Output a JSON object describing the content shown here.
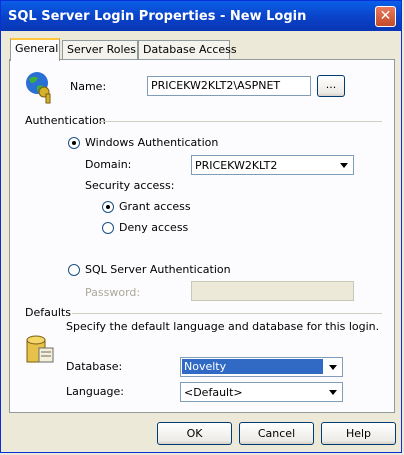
{
  "window": {
    "title": "SQL Server Login Properties - New Login",
    "close_glyph": "✕"
  },
  "tabs": [
    {
      "label": "General",
      "active": true
    },
    {
      "label": "Server Roles",
      "active": false
    },
    {
      "label": "Database Access",
      "active": false
    }
  ],
  "general": {
    "name_label": "Name:",
    "name_value": "PRICEKW2KLT2\\ASPNET",
    "browse_label": "...",
    "auth_section": "Authentication",
    "windows_auth_label": "Windows Authentication",
    "windows_auth_selected": true,
    "domain_label": "Domain:",
    "domain_value": "PRICEKW2KLT2",
    "security_access_label": "Security access:",
    "grant_label": "Grant access",
    "grant_selected": true,
    "deny_label": "Deny access",
    "sql_auth_label": "SQL Server Authentication",
    "password_label": "Password:",
    "password_value": "",
    "defaults_section": "Defaults",
    "defaults_desc": "Specify the default language and database for this login.",
    "database_label": "Database:",
    "database_value": "Novelty",
    "language_label": "Language:",
    "language_value": "<Default>"
  },
  "buttons": {
    "ok": "OK",
    "cancel": "Cancel",
    "help": "Help"
  },
  "icons": {
    "login": "globe-key-icon",
    "defaults": "database-icon"
  }
}
